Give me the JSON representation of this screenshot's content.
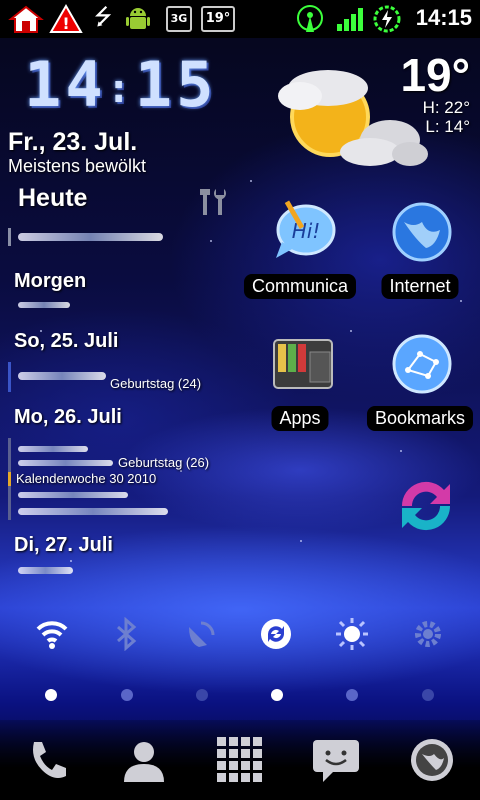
{
  "status_bar": {
    "time": "14:15",
    "network_badge": "3G",
    "temp_badge": "19°",
    "icons": [
      "home-icon",
      "warning-icon",
      "usb-icon",
      "android-icon",
      "sim-icon",
      "wifi-tether-icon",
      "signal-icon",
      "battery-charging-icon"
    ]
  },
  "clock": {
    "hour": "14",
    "minute": "15"
  },
  "weather": {
    "temp": "19°",
    "high": "H:  22°",
    "low": "L:  14°",
    "date": "Fr., 23. Jul.",
    "condition": "Meistens bewölkt"
  },
  "calendar": {
    "days": [
      {
        "label": "Heute"
      },
      {
        "label": "Morgen"
      },
      {
        "label": "So, 25. Juli",
        "event": "Geburtstag (24)"
      },
      {
        "label": "Mo, 26. Juli",
        "event1": "Geburtstag (26)",
        "event2": "Kalenderwoche 30 2010"
      },
      {
        "label": "Di, 27. Juli"
      }
    ]
  },
  "apps": [
    {
      "label": "Communica",
      "icon": "chat-bubble-icon"
    },
    {
      "label": "Internet",
      "icon": "globe-icon"
    },
    {
      "label": "Apps",
      "icon": "wallet-icon"
    },
    {
      "label": "Bookmarks",
      "icon": "bookmarks-icon"
    },
    {
      "label": "",
      "icon": "sync-app-icon"
    }
  ],
  "power_controls": [
    "wifi-icon",
    "bluetooth-icon",
    "gps-icon",
    "sync-icon",
    "brightness-icon",
    "settings-gear-icon"
  ],
  "page_indicator": {
    "count": 6,
    "active": [
      0,
      3
    ]
  },
  "dock": [
    "phone-icon",
    "contacts-icon",
    "app-drawer-icon",
    "messaging-icon",
    "browser-icon"
  ],
  "colors": {
    "accent": "#2a3fd0",
    "signal_green": "#3cff3c"
  }
}
